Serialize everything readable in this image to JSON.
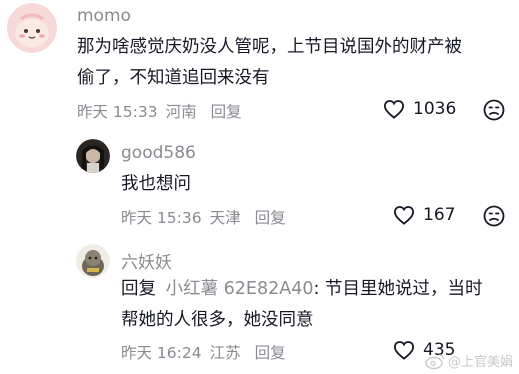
{
  "comments": [
    {
      "username": "momo",
      "text_line1": "那为啥感觉庆奶没人管呢，上节目说国外的财产被",
      "text_line2": "偷了，不知道追回来没有",
      "time": "昨天 15:33",
      "location": "河南",
      "reply_label": "回复",
      "likes": "1036"
    },
    {
      "username": "good586",
      "text_line1": "我也想问",
      "time": "昨天 15:36",
      "location": "天津",
      "reply_label": "回复",
      "likes": "167"
    },
    {
      "username": "六妖妖",
      "reply_prefix": "回复",
      "mention": "小红薯 62E82A40",
      "text_line1_rest": ": 节目里她说过，当时",
      "text_line2": "帮她的人很多，她没同意",
      "time": "昨天 16:24",
      "location": "江苏",
      "reply_label": "回复",
      "likes": "435"
    }
  ],
  "watermark": "@上官美娟",
  "colors": {
    "secondary_text": "#8a8b91",
    "primary_text": "#161823"
  }
}
